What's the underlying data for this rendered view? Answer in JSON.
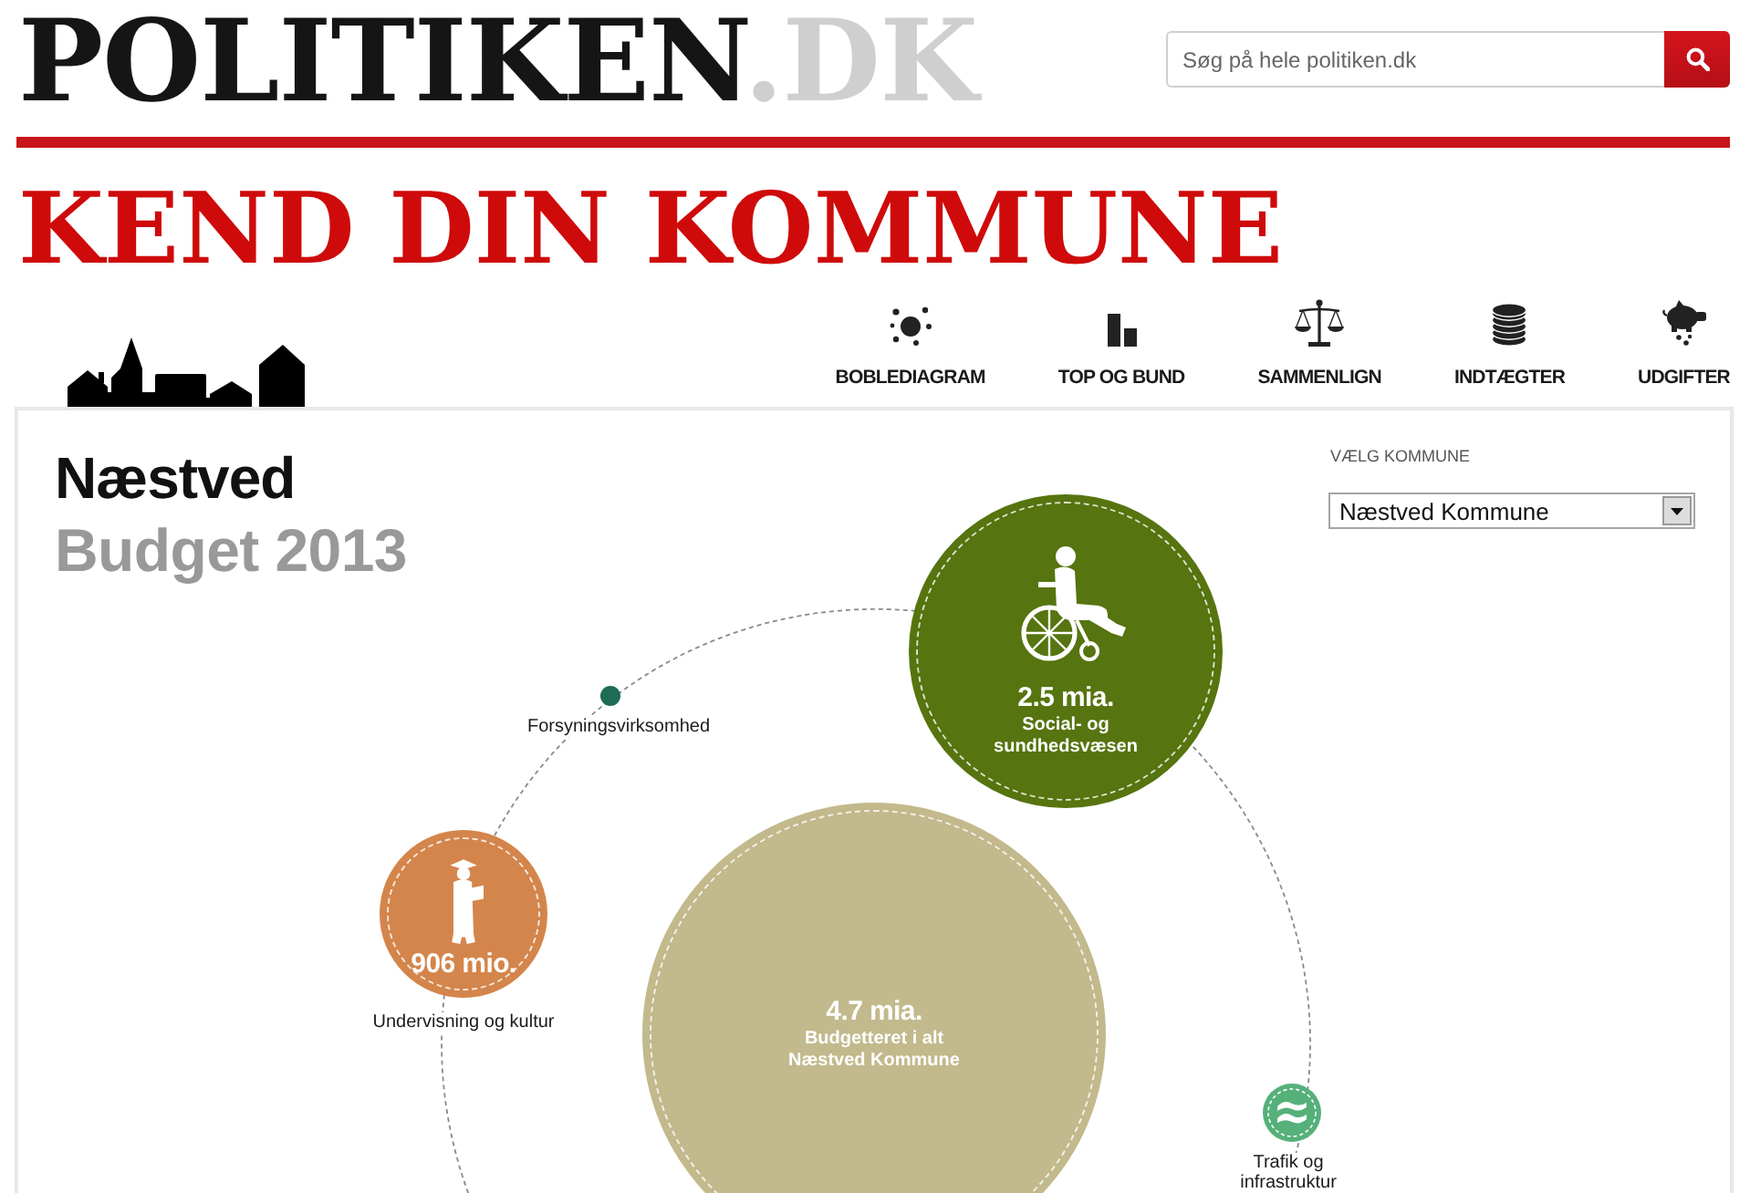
{
  "logo": {
    "name": "POLITIKEN",
    "suffix": ".DK"
  },
  "search": {
    "placeholder": "Søg på hele politiken.dk"
  },
  "page_title": "KEND DIN KOMMUNE",
  "nav": [
    {
      "kind": "bubbles",
      "label": "BOBLEDIAGRAM"
    },
    {
      "kind": "ranking",
      "label": "TOP OG BUND"
    },
    {
      "kind": "compare",
      "label": "SAMMENLIGN"
    },
    {
      "kind": "income",
      "label": "INDTÆGTER"
    },
    {
      "kind": "expenses",
      "label": "UDGIFTER"
    }
  ],
  "heading": {
    "municipality": "Næstved",
    "subtitle": "Budget 2013"
  },
  "municipality_picker": {
    "label": "VÆLG KOMMUNE",
    "value": "Næstved Kommune"
  },
  "bubbles": [
    {
      "kind": "utility",
      "color": "#1e6b56",
      "label": [
        "Forsyningsvirksomhed"
      ]
    },
    {
      "kind": "social",
      "color": "#56740f",
      "amount": "2.5 mia.",
      "caption": [
        "Social- og",
        "sundhedsvæsen"
      ]
    },
    {
      "kind": "education",
      "color": "#d4854b",
      "amount": "906 mio.",
      "label": [
        "Undervisning og kultur"
      ]
    },
    {
      "kind": "total",
      "color": "#c2b98c",
      "amount": "4.7 mia.",
      "caption": [
        "Budgetteret i alt",
        "Næstved Kommune"
      ]
    },
    {
      "kind": "traffic",
      "color": "#56b07a",
      "label": [
        "Trafik og",
        "infrastruktur"
      ]
    }
  ]
}
